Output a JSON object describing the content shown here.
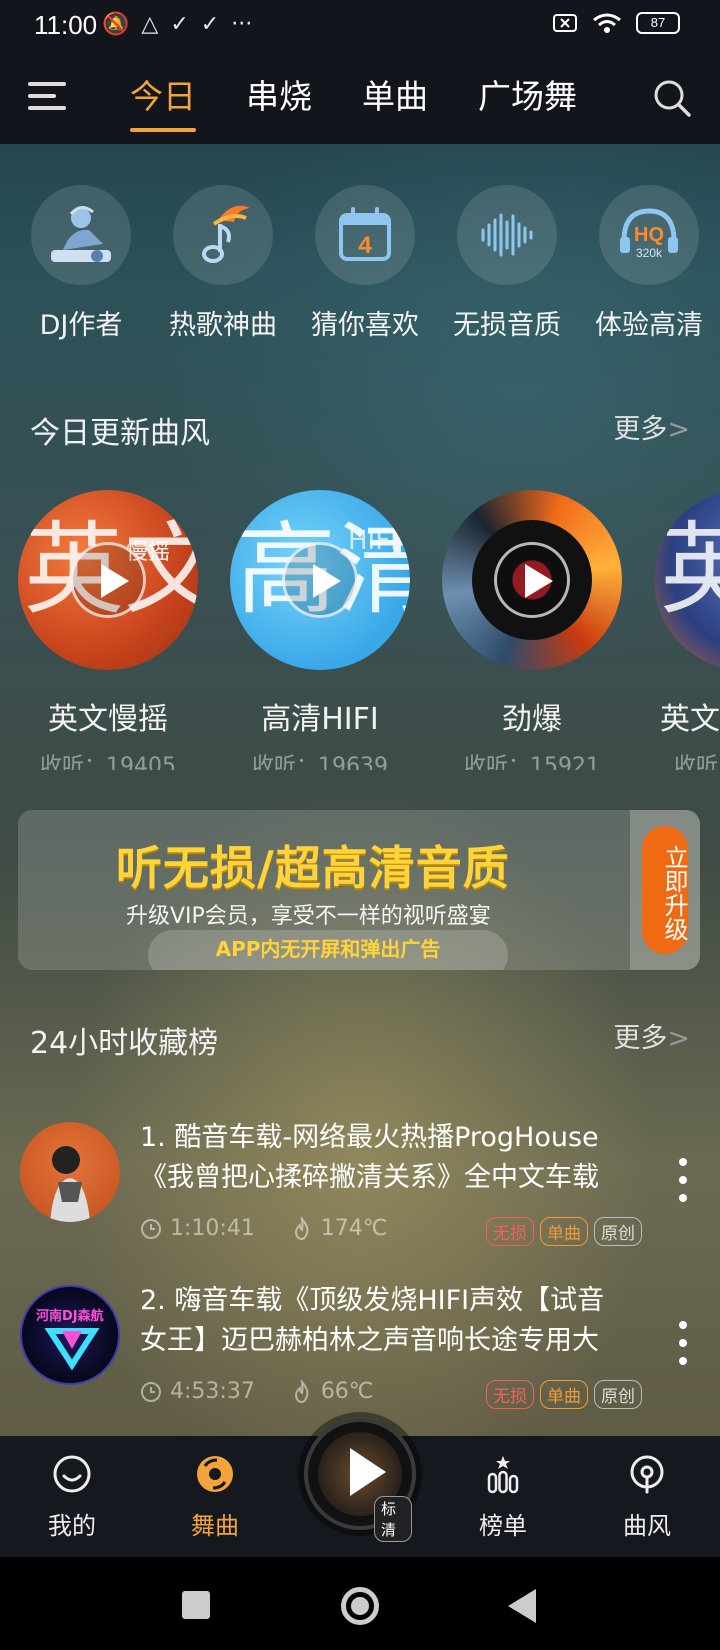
{
  "status": {
    "time": "11:00",
    "battery": "87",
    "dots": "···"
  },
  "header": {
    "tabs": [
      {
        "label": "今日",
        "active": true
      },
      {
        "label": "串烧",
        "active": false
      },
      {
        "label": "单曲",
        "active": false
      },
      {
        "label": "广场舞",
        "active": false
      }
    ]
  },
  "shortcuts": [
    {
      "label": "DJ作者",
      "icon": "dj-author-icon"
    },
    {
      "label": "热歌神曲",
      "icon": "hot-song-icon"
    },
    {
      "label": "猜你喜欢",
      "icon": "calendar-icon",
      "icon_text": "4"
    },
    {
      "label": "无损音质",
      "icon": "waveform-icon"
    },
    {
      "label": "体验高清",
      "icon": "hq-headphone-icon",
      "icon_text": "HQ",
      "icon_sub": "320k"
    }
  ],
  "today_styles": {
    "title": "今日更新曲风",
    "more": "更多",
    "items": [
      {
        "name": "英文慢摇",
        "listen": "收听：19405",
        "big_char": "英文",
        "small": "慢摇",
        "color_from": "#e0502a",
        "color_to": "#b03a18"
      },
      {
        "name": "高清HIFI",
        "listen": "收听：19639",
        "big_char": "高清",
        "small": "HIFI",
        "color_from": "#5ec8f5",
        "color_to": "#35a6e6"
      },
      {
        "name": "劲爆",
        "listen": "收听：15921",
        "big_char": "",
        "small": "",
        "color_from": "#303540",
        "color_to": "#e8601a"
      },
      {
        "name": "英文",
        "listen": "收听",
        "big_char": "英",
        "small": "",
        "color_from": "#3c5aa0",
        "color_to": "#c06a3a"
      }
    ]
  },
  "banner": {
    "title": "听无损/超高清音质",
    "subtitle": "升级VIP会员，享受不一样的视听盛宴",
    "pill": "APP内无开屏和弹出广告",
    "button": "立即升级"
  },
  "ranking": {
    "title": "24小时收藏榜",
    "more": "更多",
    "items": [
      {
        "title": "1. 酷音车载-网络最火热播ProgHouse《我曾把心揉碎撇清关系》全中文车载",
        "duration": "1:10:41",
        "heat": "174℃",
        "badges": [
          "无损",
          "单曲",
          "原创"
        ]
      },
      {
        "title": "2. 嗨音车载《顶级发烧HIFI声效【试音女王】迈巴赫柏林之声音响长途专用大",
        "duration": "4:53:37",
        "heat": "66℃",
        "badges": [
          "无损",
          "单曲",
          "原创"
        ],
        "avatar_text": "河南DJ森航"
      }
    ]
  },
  "bottom_nav": {
    "items": [
      {
        "label": "我的",
        "icon": "smile-icon",
        "active": false
      },
      {
        "label": "舞曲",
        "icon": "disc-icon",
        "active": true
      },
      {
        "label": "榜单",
        "icon": "ranking-icon",
        "active": false
      },
      {
        "label": "曲风",
        "icon": "style-icon",
        "active": false
      }
    ],
    "player_quality": "标清"
  },
  "colors": {
    "accent": "#f2a33a",
    "upgrade": "#ef6a12",
    "badge_red": "#f26060",
    "badge_orange": "#f29a3a"
  }
}
